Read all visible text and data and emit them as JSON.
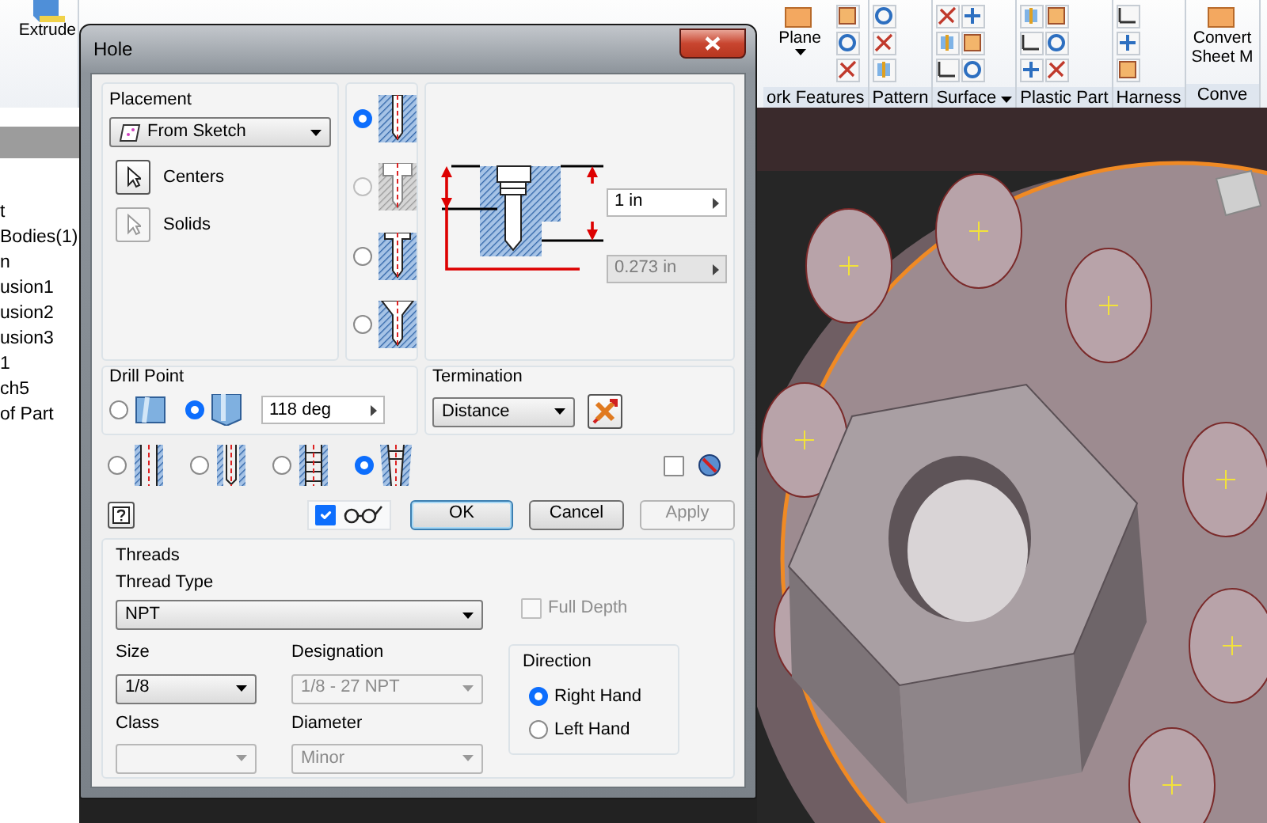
{
  "ribbon": {
    "left_buttons": [
      {
        "label": "Extrude"
      }
    ],
    "groups": [
      {
        "label": "ork Features",
        "buttons": [
          {
            "label": "Plane",
            "menu": true
          }
        ]
      },
      {
        "label": "Pattern"
      },
      {
        "label": "Surface",
        "menu": true
      },
      {
        "label": "Plastic Part"
      },
      {
        "label": "Harness"
      },
      {
        "label": "Conve",
        "buttons": [
          {
            "label": "Convert Sheet M"
          }
        ]
      }
    ]
  },
  "browser": {
    "items": [
      "t",
      "Bodies(1)",
      "n",
      "usion1",
      "usion2",
      "usion3",
      "1",
      "ch5",
      "of Part"
    ]
  },
  "window": {
    "title": "Hole"
  },
  "placement": {
    "title": "Placement",
    "method": "From Sketch",
    "selectors": [
      {
        "label": "Centers",
        "active": true
      },
      {
        "label": "Solids",
        "active": false
      }
    ]
  },
  "hole_types": [
    {
      "kind": "drilled",
      "selected": true,
      "disabled": false
    },
    {
      "kind": "counterbore",
      "selected": false,
      "disabled": true
    },
    {
      "kind": "spotface",
      "selected": false,
      "disabled": false
    },
    {
      "kind": "countersink",
      "selected": false,
      "disabled": false
    }
  ],
  "preview": {
    "depth": "1 in",
    "diameter": "0.273 in",
    "diameter_disabled": true
  },
  "drill_point": {
    "title": "Drill Point",
    "options": [
      {
        "kind": "flat",
        "selected": false
      },
      {
        "kind": "angle",
        "selected": true
      }
    ],
    "angle": "118 deg"
  },
  "termination": {
    "title": "Termination",
    "value": "Distance"
  },
  "thread_types": [
    {
      "kind": "simple",
      "selected": false
    },
    {
      "kind": "clearance",
      "selected": false
    },
    {
      "kind": "tapped",
      "selected": false
    },
    {
      "kind": "taper_tapped",
      "selected": true
    }
  ],
  "infer_checked": false,
  "preview_checked": true,
  "buttons": [
    {
      "label": "OK",
      "default": true,
      "disabled": false
    },
    {
      "label": "Cancel",
      "default": false,
      "disabled": false
    },
    {
      "label": "Apply",
      "default": false,
      "disabled": true
    }
  ],
  "threads": {
    "title": "Threads",
    "thread_type_label": "Thread Type",
    "thread_type": "NPT",
    "full_depth": {
      "label": "Full Depth",
      "checked": false,
      "disabled": true
    },
    "fields": [
      {
        "label": "Size",
        "value": "1/8",
        "disabled": false
      },
      {
        "label": "Designation",
        "value": "1/8 - 27 NPT",
        "disabled": true
      },
      {
        "label": "Class",
        "disabled": true
      },
      {
        "label": "Diameter",
        "value": "Minor",
        "disabled": true
      }
    ],
    "direction": {
      "title": "Direction",
      "options": [
        {
          "label": "Right Hand",
          "selected": true
        },
        {
          "label": "Left Hand",
          "selected": false
        }
      ]
    }
  }
}
